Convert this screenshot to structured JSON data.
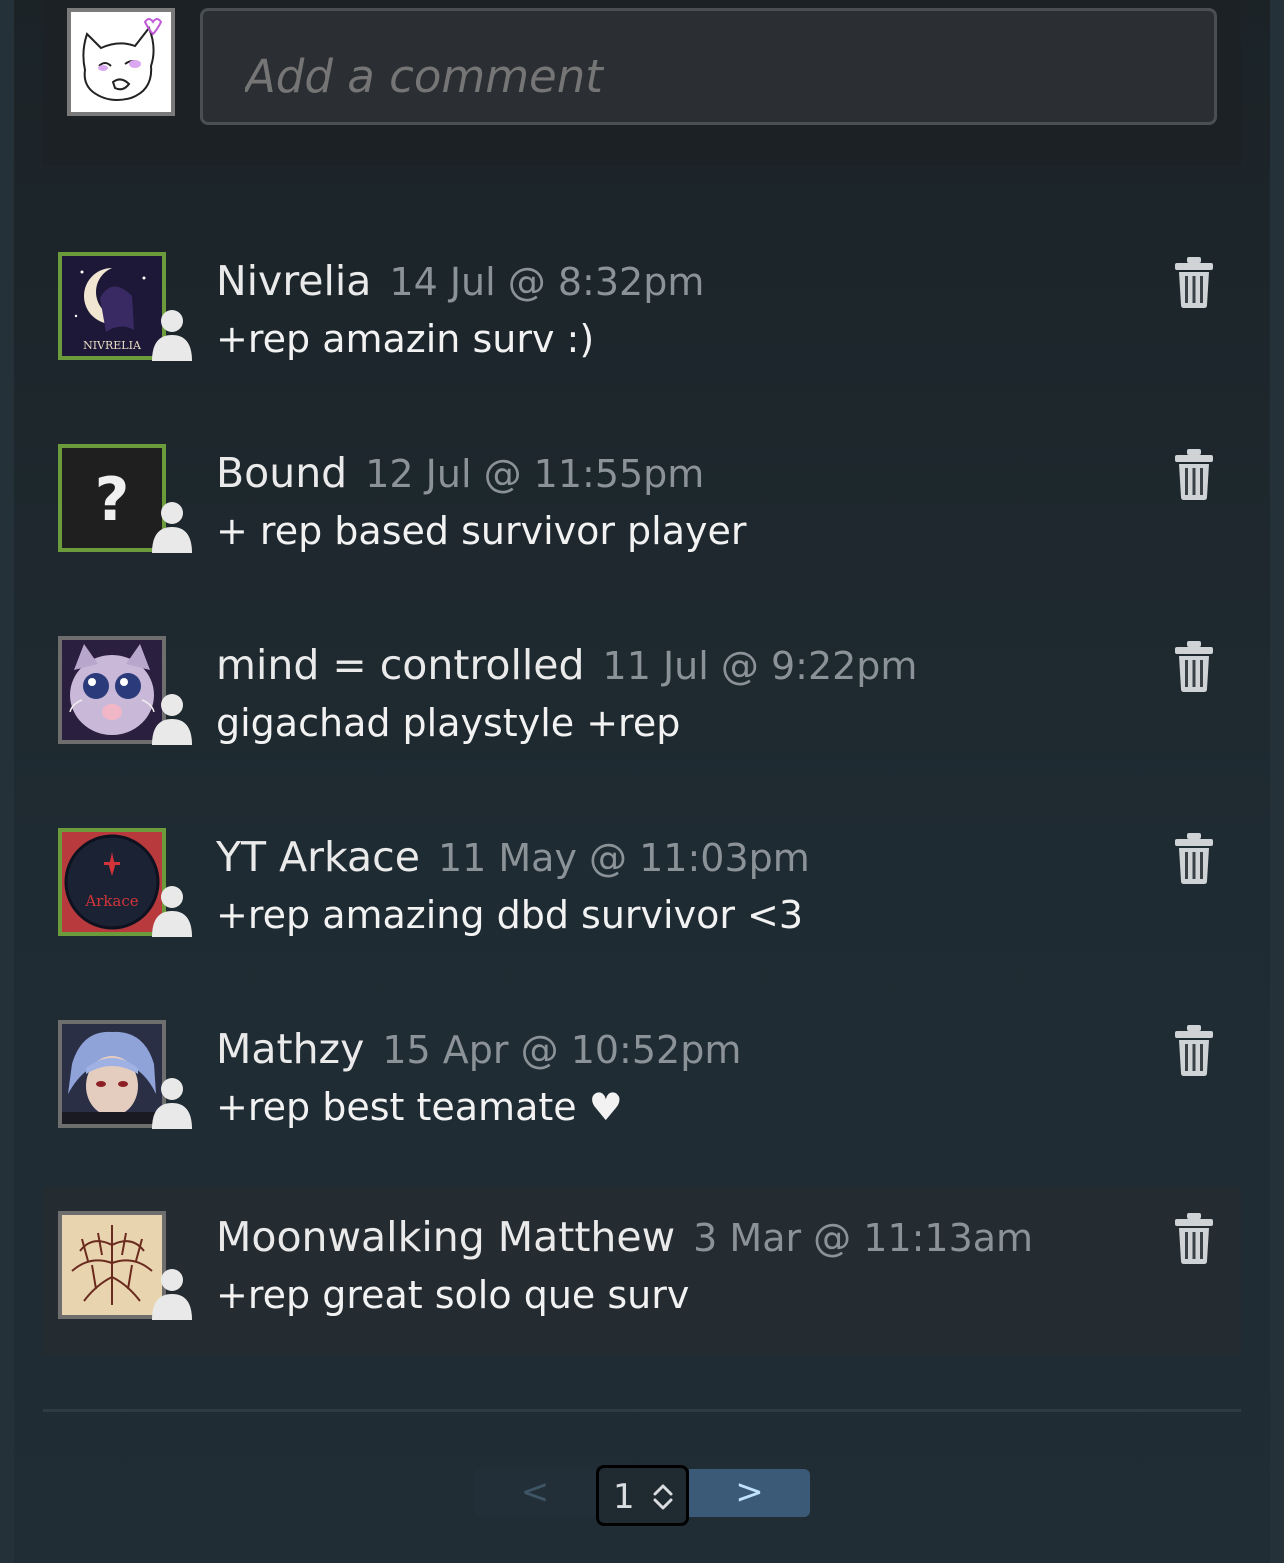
{
  "compose": {
    "placeholder": "Add a comment"
  },
  "comments": [
    {
      "author": "Nivrelia",
      "timestamp": "14 Jul @ 8:32pm",
      "text": "+rep amazin surv :)",
      "avatar_text": "NIVRELIA",
      "status": "online"
    },
    {
      "author": "Bound",
      "timestamp": "12 Jul @ 11:55pm",
      "text": "+ rep based survivor player",
      "avatar_text": "?",
      "status": "online"
    },
    {
      "author": "mind = controlled",
      "timestamp": "11 Jul @ 9:22pm",
      "text": "gigachad playstyle +rep",
      "status": "offline"
    },
    {
      "author": "YT Arkace",
      "timestamp": "11 May @ 11:03pm",
      "text": "+rep amazing dbd survivor <3",
      "avatar_text": "Arkace",
      "status": "online"
    },
    {
      "author": "Mathzy",
      "timestamp": "15 Apr @ 10:52pm",
      "text": "+rep best teamate ♥",
      "status": "offline"
    },
    {
      "author": "Moonwalking Matthew",
      "timestamp": "3 Mar @ 11:13am",
      "text": "+rep great solo que surv",
      "status": "offline"
    }
  ],
  "pagination": {
    "prev_label": "<",
    "current_page": "1",
    "next_label": ">"
  },
  "icons": {
    "delete": "trash-icon",
    "friend": "friend-silhouette-icon",
    "page_select": "chevron-up-down-icon"
  },
  "colors": {
    "online_border": "#6b9b3a",
    "offline_border": "#6e6e6e",
    "next_button": "#3b5a78"
  }
}
